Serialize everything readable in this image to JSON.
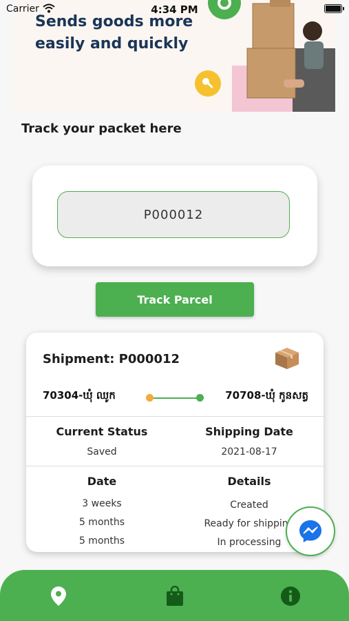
{
  "status_bar": {
    "carrier": "Carrier",
    "time": "4:34 PM"
  },
  "banner": {
    "title": "Sends goods more easily and quickly"
  },
  "tracking": {
    "section_title": "Track your packet here",
    "input_value": "P000012",
    "button_label": "Track Parcel"
  },
  "shipment": {
    "title": "Shipment: P000012",
    "origin": "70304-ឃុំ ឈូក",
    "destination": "70708-ឃុំ កូនសត្វ",
    "current_status_label": "Current Status",
    "current_status": "Saved",
    "shipping_date_label": "Shipping Date",
    "shipping_date": "2021-08-17",
    "date_header": "Date",
    "details_header": "Details",
    "history": [
      {
        "date": "3 weeks",
        "detail": "Created"
      },
      {
        "date": "5 months",
        "detail": "Ready for shipping"
      },
      {
        "date": "5 months",
        "detail": "In processing"
      }
    ]
  },
  "colors": {
    "accent": "#4caf50",
    "origin_dot": "#f6a93b",
    "messenger": "#1a73e8"
  },
  "icons": {
    "nav": [
      "location-pin-icon",
      "shopping-bag-icon",
      "info-icon"
    ],
    "messenger": "messenger-icon",
    "package": "package-box-icon"
  }
}
